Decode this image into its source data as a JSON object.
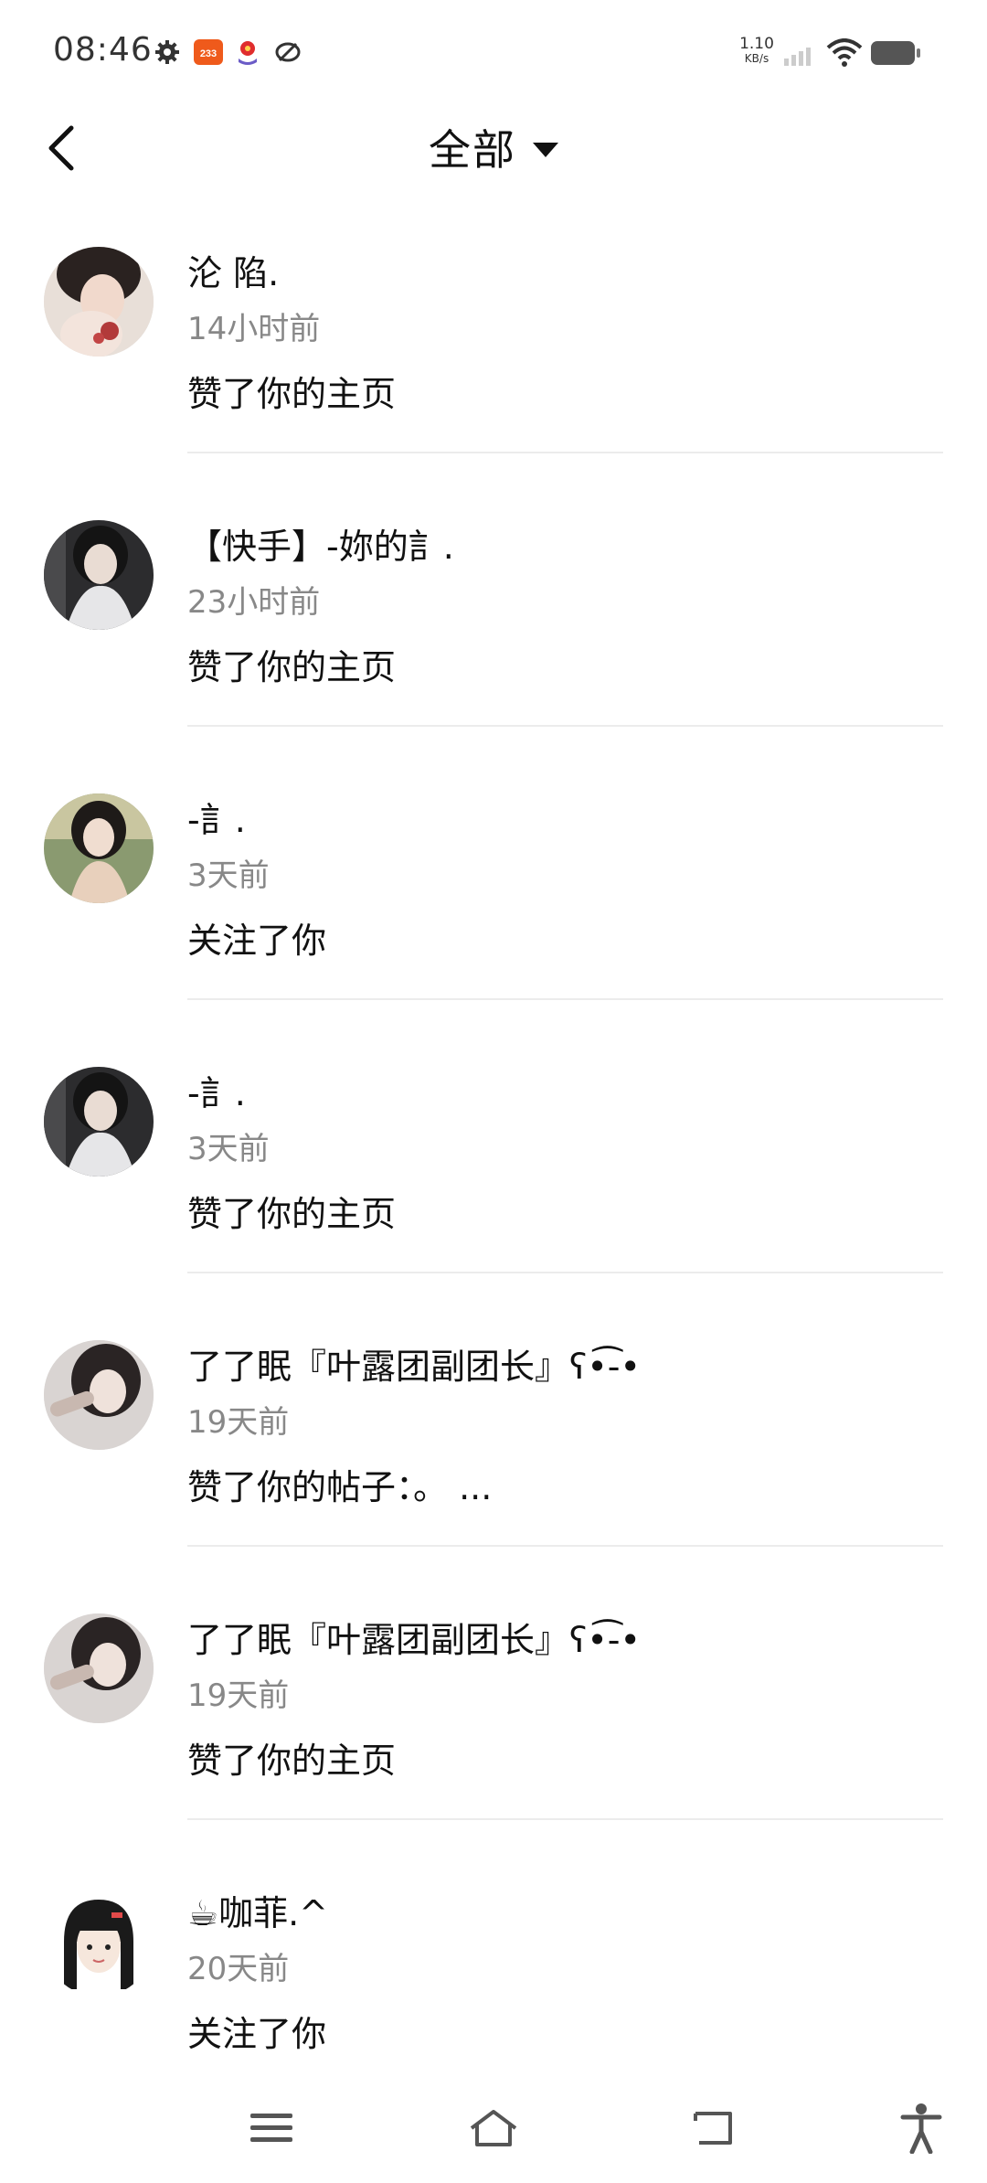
{
  "status_bar": {
    "time": "08:46",
    "net_speed_value": "1.10",
    "net_speed_unit": "KB/s",
    "icons": [
      "gear-icon",
      "app-233-icon",
      "app-badge-icon",
      "link-icon",
      "signal-icon",
      "wifi-icon",
      "battery-icon"
    ],
    "app_233_label": "233"
  },
  "header": {
    "title": "全部",
    "back_icon": "chevron-left-icon",
    "dropdown_icon": "caret-down-icon"
  },
  "notifications": [
    {
      "name": "沦 陷.",
      "time": "14小时前",
      "action": "赞了你的主页"
    },
    {
      "name": "【快手】-妳的訁.",
      "time": "23小时前",
      "action": "赞了你的主页"
    },
    {
      "name": "-訁.",
      "time": "3天前",
      "action": "关注了你"
    },
    {
      "name": "-訁.",
      "time": "3天前",
      "action": "赞了你的主页"
    },
    {
      "name": "了了眠『叶露团副团长』ʕ•͡-•",
      "time": "19天前",
      "action": "赞了你的帖子：。          ..."
    },
    {
      "name": "了了眠『叶露团副团长』ʕ•͡-•",
      "time": "19天前",
      "action": "赞了你的主页"
    },
    {
      "name": "☕咖菲.^",
      "time": "20天前",
      "action": "关注了你"
    }
  ],
  "nav_bar": {
    "icons": [
      "menu-icon",
      "home-icon",
      "back-icon",
      "accessibility-icon"
    ]
  },
  "colors": {
    "text_primary": "#111111",
    "text_secondary": "#888888",
    "divider": "#ececec",
    "background": "#ffffff"
  }
}
